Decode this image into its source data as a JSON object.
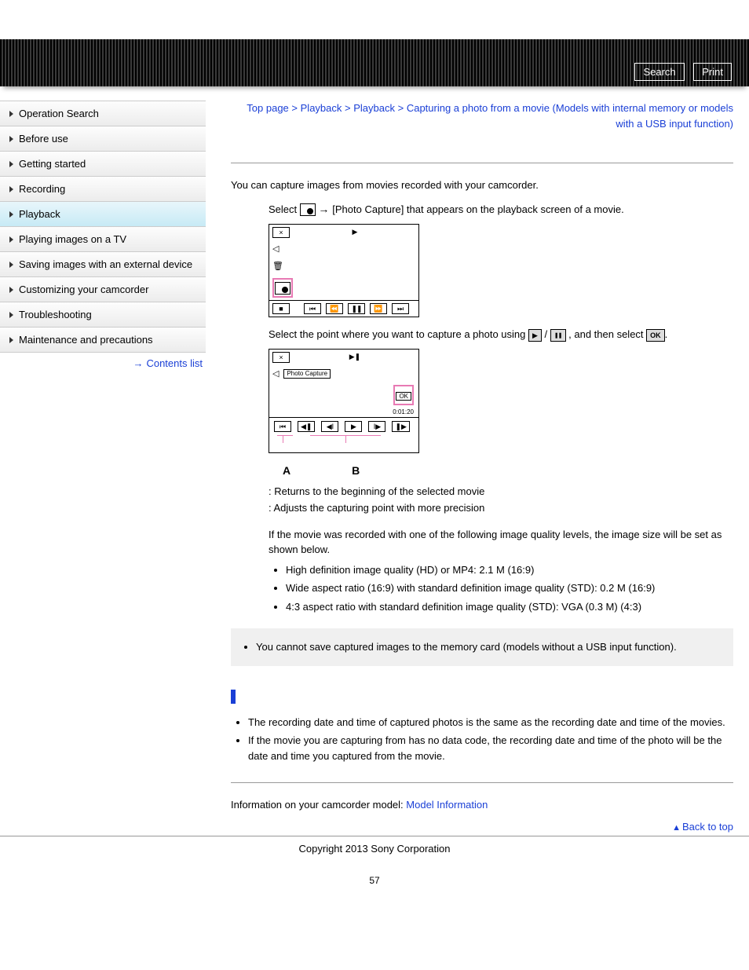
{
  "topbar": {
    "search_label": "Search",
    "print_label": "Print"
  },
  "sidebar": {
    "items": [
      {
        "label": "Operation Search",
        "active": false
      },
      {
        "label": "Before use",
        "active": false
      },
      {
        "label": "Getting started",
        "active": false
      },
      {
        "label": "Recording",
        "active": false
      },
      {
        "label": "Playback",
        "active": true
      },
      {
        "label": "Playing images on a TV",
        "active": false
      },
      {
        "label": "Saving images with an external device",
        "active": false
      },
      {
        "label": "Customizing your camcorder",
        "active": false
      },
      {
        "label": "Troubleshooting",
        "active": false
      },
      {
        "label": "Maintenance and precautions",
        "active": false
      }
    ],
    "contents_list_label": "Contents list"
  },
  "breadcrumb": {
    "top": "Top page",
    "cat1": "Playback",
    "cat2": "Playback",
    "title": "Capturing a photo from a movie (Models with internal memory or models with a USB input function)"
  },
  "body": {
    "intro": "You can capture images from movies recorded with your camcorder.",
    "step1_pre": "Select ",
    "step1_post": " [Photo Capture] that appears on the playback screen of a movie.",
    "step2_pre": "Select the point where you want to capture a photo using ",
    "step2_mid": " / ",
    "step2_post": ", and then select ",
    "step2_end": ".",
    "legend_a": ": Returns to the beginning of the selected movie",
    "legend_b": ": Adjusts the capturing point with more precision",
    "quality_intro": "If the movie was recorded with one of the following image quality levels, the image size will be set as shown below.",
    "quality_items": [
      "High definition image quality (HD) or MP4: 2.1 M (16:9)",
      "Wide aspect ratio (16:9) with standard definition image quality (STD): 0.2 M (16:9)",
      "4:3 aspect ratio with standard definition image quality (STD): VGA (0.3 M) (4:3)"
    ],
    "note_item": "You cannot save captured images to the memory card (models without a USB input function).",
    "tips": [
      "The recording date and time of captured photos is the same as the recording date and time of the movies.",
      "If the movie you are capturing from has no data code, the recording date and time of the photo will be the date and time you captured from the movie."
    ],
    "model_info_pre": "Information on your camcorder model: ",
    "model_info_link": "Model Information",
    "back_to_top": "Back to top",
    "copyright": "Copyright 2013 Sony Corporation",
    "page_number": "57",
    "photo_capture_label": "Photo Capture",
    "ok_label": "OK",
    "timecode": "0:01:20",
    "letter_a": "A",
    "letter_b": "B"
  }
}
